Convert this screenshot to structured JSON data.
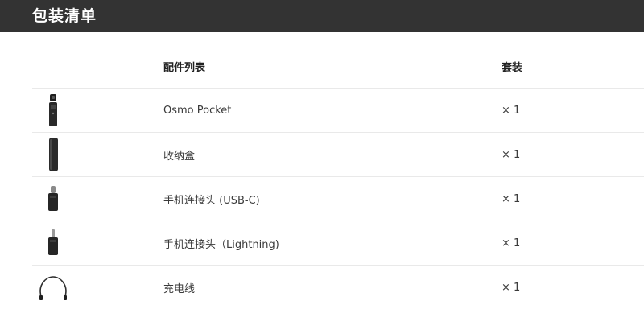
{
  "header": {
    "title": "包装清单"
  },
  "table": {
    "columns": {
      "item": "配件列表",
      "qty": "套装"
    },
    "rows": [
      {
        "name": "Osmo Pocket",
        "qty": "× 1",
        "icon": "osmo-pocket-icon"
      },
      {
        "name": "收纳盒",
        "qty": "× 1",
        "icon": "storage-case-icon"
      },
      {
        "name": "手机连接头 (USB-C)",
        "qty": "× 1",
        "icon": "usb-c-adapter-icon"
      },
      {
        "name": "手机连接头（Lightning)",
        "qty": "× 1",
        "icon": "lightning-adapter-icon"
      },
      {
        "name": "充电线",
        "qty": "× 1",
        "icon": "charging-cable-icon"
      }
    ]
  },
  "colors": {
    "header_bg": "#333333",
    "header_text": "#ffffff",
    "divider": "#e9e9e9"
  }
}
